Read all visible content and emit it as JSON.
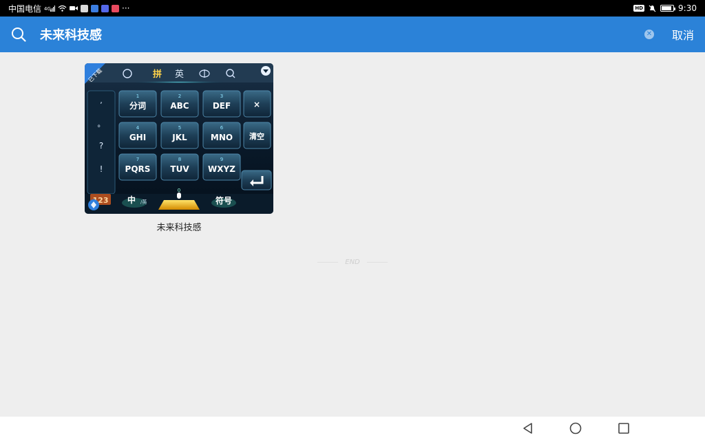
{
  "status_bar": {
    "carrier": "中国电信",
    "overflow": "···",
    "time": "9:30",
    "hd_badge": "HD",
    "battery_level": 0.85
  },
  "search": {
    "query": "未来科技感",
    "clear_icon": "clear-circle-icon",
    "cancel_label": "取消"
  },
  "results": [
    {
      "caption": "未来科技感",
      "ribbon": "已下载",
      "keyboard": {
        "tabs": [
          "拼",
          "英"
        ],
        "left_punct": [
          ",",
          "。",
          "?",
          "!"
        ],
        "keys": [
          {
            "num": "1",
            "label": "分词"
          },
          {
            "num": "2",
            "label": "ABC"
          },
          {
            "num": "3",
            "label": "DEF"
          },
          {
            "num": "4",
            "label": "GHI"
          },
          {
            "num": "5",
            "label": "JKL"
          },
          {
            "num": "6",
            "label": "MNO"
          },
          {
            "num": "7",
            "label": "PQRS"
          },
          {
            "num": "8",
            "label": "TUV"
          },
          {
            "num": "9",
            "label": "WXYZ"
          }
        ],
        "right_keys": [
          "×",
          "清空"
        ],
        "bottom": {
          "num_label": "123",
          "lang": "中",
          "lang_small": "/英",
          "zero": "0",
          "symbols": "符号"
        }
      }
    }
  ],
  "end_text": "END",
  "colors": {
    "accent": "#2b82d8",
    "background": "#eeeeee"
  }
}
